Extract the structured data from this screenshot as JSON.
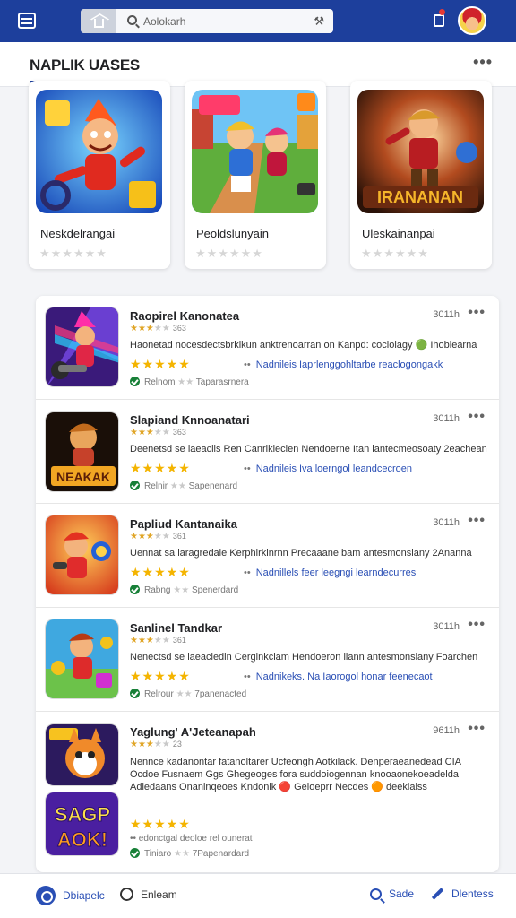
{
  "topbar": {
    "search_placeholder": "Aolokarh",
    "icons": [
      "menu-icon",
      "home-icon",
      "search-icon",
      "tools-icon",
      "notification-icon",
      "avatar"
    ]
  },
  "header": {
    "title": "NAPLIK UASES",
    "more": "•••"
  },
  "featured": [
    {
      "title": "Neskdelrangai",
      "stars": "★★★★★★",
      "rating": 0
    },
    {
      "title": "Peoldslunyain",
      "stars": "★★★★★★",
      "rating": 0
    },
    {
      "title": "Uleskainanpai",
      "stars": "★★★★★★",
      "rating": 0
    }
  ],
  "items": [
    {
      "title": "Raopirel Kanonatea",
      "time": "3011h",
      "more": "•••",
      "small_on": "★★★",
      "small_off": "★★",
      "small_count": "363",
      "desc": "Haonetad nocesdectsbrkikun anktrenoarran on Kanpd: coclolagy 🟢 Ihoblearna",
      "big_stars": "★★★★★",
      "link_dots": "••",
      "link": "Nadnileis Iaprlenggohltarbe reaclogongakk",
      "meta_label": "Relnom",
      "meta_stars": "★★",
      "meta_after": "Taparasrnera"
    },
    {
      "title": "Slapiand Knnoanatari",
      "time": "3011h",
      "more": "•••",
      "small_on": "★★★",
      "small_off": "★★",
      "small_count": "363",
      "desc": "Deenetsd se laeaclls Ren Canrikleclen Nendoerne Itan lantecmeosoaty 2eachean",
      "big_stars": "★★★★★",
      "link_dots": "••",
      "link": "Nadnileis Iva loerngol leandcecroen",
      "meta_label": "Relnir",
      "meta_stars": "★★",
      "meta_after": "Sapenenard"
    },
    {
      "title": "Papliud Kantanaika",
      "time": "3011h",
      "more": "•••",
      "small_on": "★★★",
      "small_off": "★★",
      "small_count": "361",
      "desc": "Uennat sa laragredale Kerphirkinrnn Precaaane bam antesmonsiany 2Ananna",
      "big_stars": "★★★★★",
      "link_dots": "••",
      "link": "Nadnillels feer leegngi learndecurres",
      "meta_label": "Rabng",
      "meta_stars": "★★",
      "meta_after": "Spenerdard"
    },
    {
      "title": "Sanlinel Tandkar",
      "time": "3011h",
      "more": "•••",
      "small_on": "★★★",
      "small_off": "★★",
      "small_count": "361",
      "desc": "Nenectsd se laeacledln Cerglnkciam Hendoeron liann antesmonsiany Foarchen",
      "big_stars": "★★★★★",
      "link_dots": "••",
      "link": "Nadnikeks. Na Iaorogol honar feenecaot",
      "meta_label": "Relrour",
      "meta_stars": "★★",
      "meta_after": "7panenacted"
    },
    {
      "title": "Yaglung' A'Jeteanapah",
      "time": "9611h",
      "more": "•••",
      "small_on": "★★★",
      "small_off": "★★",
      "small_count": "23",
      "desc": "Nennce kadanontar fatanoltarer Ucfeongh Aotkilack. Denperaeanedead CIA Ocdoe Fusnaem Ggs Ghegeoges fora suddoiogennan knooaonekoeadelda Adiedaans Onaninqeoes Kndonik 🔴 Geloeprr Necdes 🟠 deekiaiss",
      "big_stars": "★★★★★",
      "link_dots": "",
      "link": "",
      "meta_label": "Tiniaro",
      "meta_stars": "★★",
      "meta_after": "7Papenardard",
      "meta2": "•• edonctgal deoloe rel ounerat"
    }
  ],
  "bottom": {
    "left_label": "Dbiapelc",
    "chat_label": "Enleam",
    "search_label": "Sade",
    "edit_label": "Dlentess"
  },
  "colors": {
    "brand": "#1d3f9c",
    "accent": "#2a4fb5",
    "star": "#f4b400",
    "check": "#188038"
  }
}
